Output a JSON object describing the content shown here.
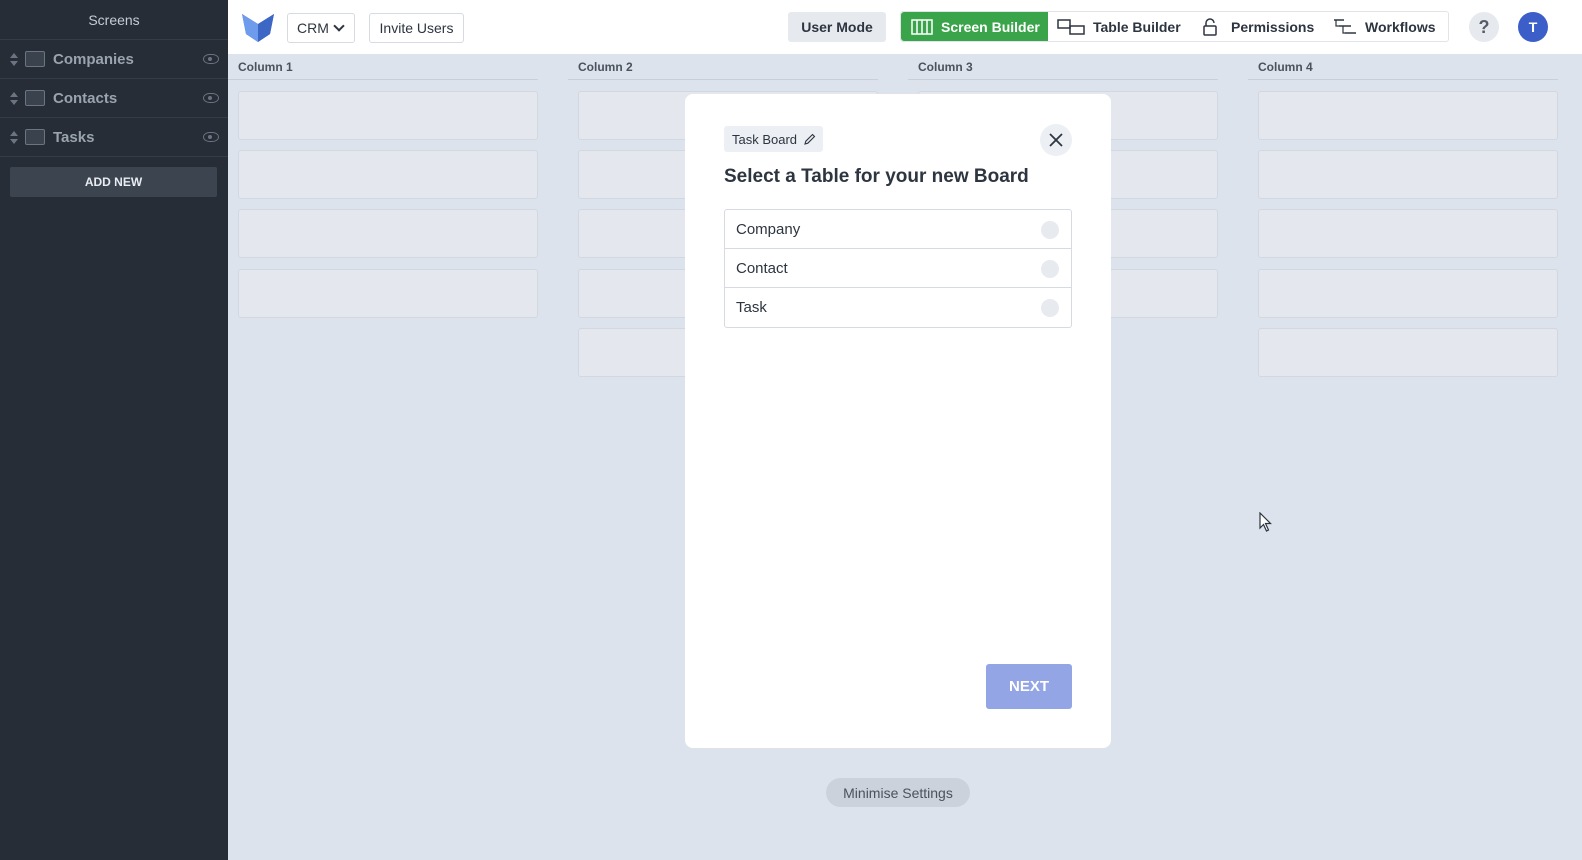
{
  "sidebar": {
    "title": "Screens",
    "items": [
      {
        "label": "Companies"
      },
      {
        "label": "Contacts"
      },
      {
        "label": "Tasks"
      }
    ],
    "add_new_label": "ADD NEW"
  },
  "header": {
    "app_selector": "CRM",
    "invite_label": "Invite Users",
    "user_mode_label": "User Mode",
    "nav": [
      {
        "label": "Screen Builder",
        "icon": "columns-icon",
        "active": true
      },
      {
        "label": "Table Builder",
        "icon": "table-builder-icon"
      },
      {
        "label": "Permissions",
        "icon": "lock-icon"
      },
      {
        "label": "Workflows",
        "icon": "workflow-icon"
      }
    ],
    "help_label": "?",
    "avatar_initial": "T",
    "active_color": "#3aa44a",
    "avatar_color": "#3c5ec9"
  },
  "board": {
    "columns": [
      {
        "title": "Column 1"
      },
      {
        "title": "Column 2"
      },
      {
        "title": "Column 3"
      },
      {
        "title": "Column 4"
      }
    ]
  },
  "modal": {
    "board_name": "Task Board",
    "title": "Select a Table for your new Board",
    "options": [
      {
        "label": "Company"
      },
      {
        "label": "Contact"
      },
      {
        "label": "Task"
      }
    ],
    "next_label": "NEXT",
    "next_color": "#93a5e4"
  },
  "footer": {
    "minimise_label": "Minimise Settings"
  }
}
